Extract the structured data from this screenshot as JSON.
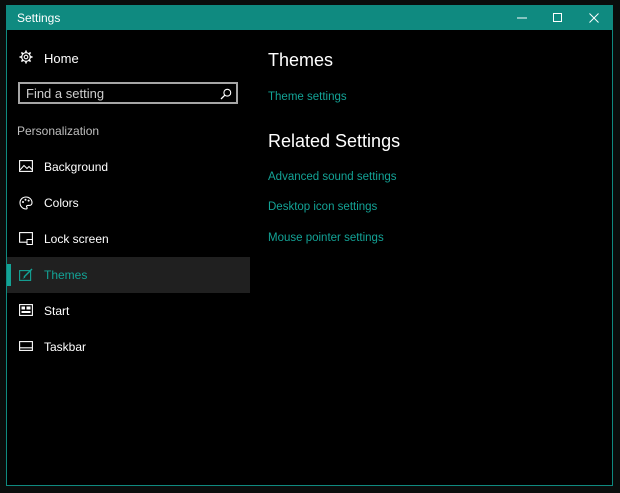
{
  "window": {
    "title": "Settings",
    "controls": {
      "minimize": "minimize-icon",
      "maximize": "maximize-icon",
      "close": "close-icon"
    }
  },
  "colors": {
    "accent": "#13a396",
    "titlebar": "#0f8a80",
    "background": "#000000",
    "active_item_bg": "#202020"
  },
  "sidebar": {
    "home_label": "Home",
    "search": {
      "placeholder": "Find a setting",
      "value": ""
    },
    "section_label": "Personalization",
    "items": [
      {
        "label": "Background",
        "icon": "image-icon",
        "active": false
      },
      {
        "label": "Colors",
        "icon": "palette-icon",
        "active": false
      },
      {
        "label": "Lock screen",
        "icon": "lock-screen-icon",
        "active": false
      },
      {
        "label": "Themes",
        "icon": "brush-icon",
        "active": true
      },
      {
        "label": "Start",
        "icon": "start-menu-icon",
        "active": false
      },
      {
        "label": "Taskbar",
        "icon": "taskbar-icon",
        "active": false
      }
    ]
  },
  "main": {
    "themes_heading": "Themes",
    "theme_settings_link": "Theme settings",
    "related_heading": "Related Settings",
    "related_links": [
      "Advanced sound settings",
      "Desktop icon settings",
      "Mouse pointer settings"
    ]
  }
}
